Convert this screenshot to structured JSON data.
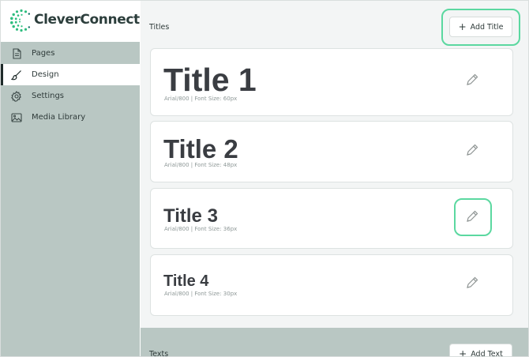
{
  "brand": {
    "name": "CleverConnect",
    "accent": "#2dbd7e"
  },
  "sidebar": {
    "items": [
      {
        "label": "Pages",
        "icon": "document-icon",
        "active": false
      },
      {
        "label": "Design",
        "icon": "brush-icon",
        "active": true
      },
      {
        "label": "Settings",
        "icon": "gear-icon",
        "active": false
      },
      {
        "label": "Media Library",
        "icon": "image-icon",
        "active": false
      }
    ]
  },
  "titles_section": {
    "heading": "Titles",
    "add_label": "Add Title",
    "cards": [
      {
        "title": "Title 1",
        "spec": "Arial/800 | Font Size: 60px"
      },
      {
        "title": "Title 2",
        "spec": "Arial/800 | Font Size: 48px"
      },
      {
        "title": "Title 3",
        "spec": "Arial/800 | Font Size: 36px"
      },
      {
        "title": "Title 4",
        "spec": "Arial/800 | Font Size: 30px"
      }
    ]
  },
  "texts_section": {
    "heading": "Texts",
    "add_label": "Add Text"
  },
  "colors": {
    "sidebar_bg": "#b9c7c3",
    "highlight": "#5bd8a0",
    "title_text": "#3a3d42"
  }
}
